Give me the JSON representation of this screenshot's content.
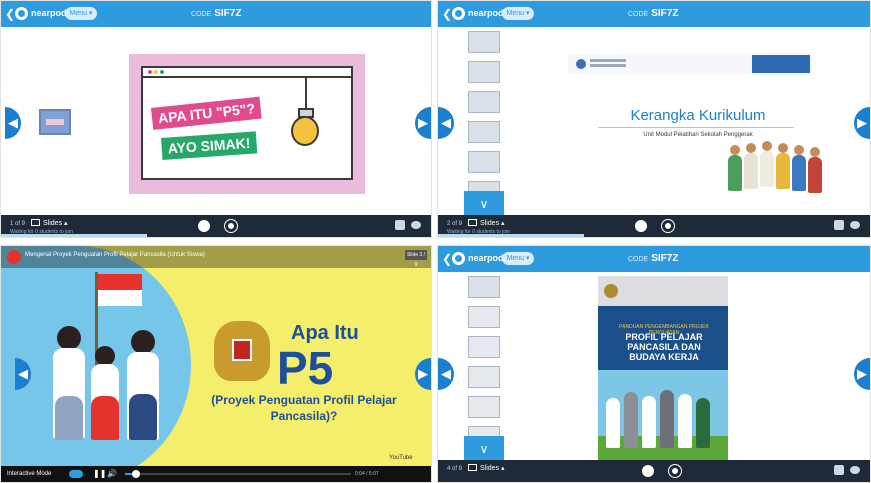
{
  "app": {
    "brand": "nearpod",
    "menu_label": "Menu",
    "code_label": "CODE",
    "code_value": "SIF7Z"
  },
  "panel1": {
    "slide_text_1": "APA ITU \"P5\"?",
    "slide_text_2": "AYO SIMAK!",
    "page_indicator": "1 of 9",
    "slides_label": "Slides",
    "status": "Waiting for 0 students to join"
  },
  "panel2": {
    "title": "Kerangka Kurikulum",
    "subtitle": "Unit Modul Pelatihan Sekolah Penggerak",
    "page_indicator": "2 of 9",
    "slides_label": "Slides",
    "status": "Waiting for 0 students to join"
  },
  "panel3": {
    "video_title": "Mengenal Proyek Penguatan Profil Pelajar Pancasila (Untuk Siswa)",
    "heading_1": "Apa Itu",
    "heading_2": "P5",
    "heading_3": "(Proyek Penguatan Profil Pelajar Pancasila)?",
    "interactive_mode_label": "Interactive Mode",
    "youtube_label": "YouTube",
    "time_display": "0:04 / 5:07",
    "slide_badge": "Slide 3 / 9"
  },
  "panel4": {
    "cover_subtitle": "PANDUAN PENGEMBANGAN PROJEK PENGUATAN",
    "cover_title": "PROFIL PELAJAR PANCASILA DAN BUDAYA KERJA",
    "page_indicator": "4 of 9",
    "slides_label": "Slides"
  },
  "colors": {
    "nearpod_blue": "#2e9bde",
    "arrow_blue": "#1b7fd0",
    "bottom_bar": "#1e2a38"
  }
}
